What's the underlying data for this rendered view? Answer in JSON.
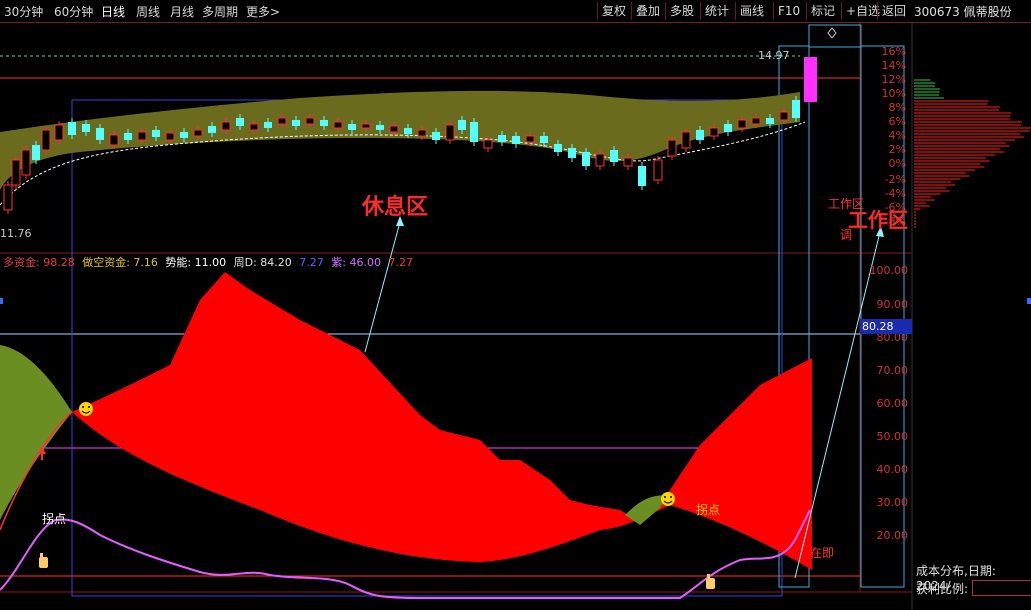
{
  "toolbar": {
    "periods": [
      "30分钟",
      "60分钟",
      "日线",
      "周线",
      "月线",
      "多周期",
      "更多>"
    ],
    "buttons": [
      "复权",
      "叠加",
      "多股",
      "统计",
      "画线",
      "F10",
      "标记",
      "+自选",
      "返回"
    ],
    "stock": "300673 佩蒂股份"
  },
  "price_panel": {
    "high_label": "14.97",
    "low_label": "11.76",
    "pct_ticks": [
      "16%",
      "14%",
      "12%",
      "10%",
      "8%",
      "6%",
      "4%",
      "2%",
      "0%",
      "-2%",
      "-4%",
      "-6%",
      "-8%"
    ],
    "annotation_rest": "休息区",
    "annotation_work_small": "工作区",
    "annotation_work_big": "工作区",
    "annotation_adjust": "调"
  },
  "indicator": {
    "items": [
      {
        "text": "多资金: 98.28",
        "color": "#e83c3c"
      },
      {
        "text": "做空资金: 7.16",
        "color": "#e0c020"
      },
      {
        "text": "势能: 11.00",
        "color": "#ffffff"
      },
      {
        "text": "周D: 84.20",
        "color": "#e0e0e0"
      },
      {
        "text": "7.27",
        "color": "#6060ff"
      },
      {
        "text": "紫: 46.00",
        "color": "#d070ff"
      },
      {
        "text": "7.27",
        "color": "#e83c3c"
      }
    ],
    "y_ticks": [
      "100.00",
      "90.00",
      "80.00",
      "70.00",
      "60.00",
      "50.00",
      "40.00",
      "30.00",
      "20.00"
    ],
    "current_value": "80.28",
    "label_turn_left": "拐点",
    "label_turn_right": "拐点",
    "label_soon": "在即"
  },
  "chip_panel": {
    "date_label": "成本分布,日期: 2024/",
    "profit_label": "获利比例:"
  },
  "colors": {
    "up": "#ff3232",
    "down": "#54ffff",
    "olive": "#6b6b1e",
    "red_fill": "#ff0000",
    "green_fill": "#6b8e23",
    "magenta": "#ff40ff",
    "purple": "#e060ff"
  },
  "icons": [
    "smiley-icon",
    "hand-pointer-icon",
    "diamond-icon",
    "arrow-up-icon"
  ]
}
